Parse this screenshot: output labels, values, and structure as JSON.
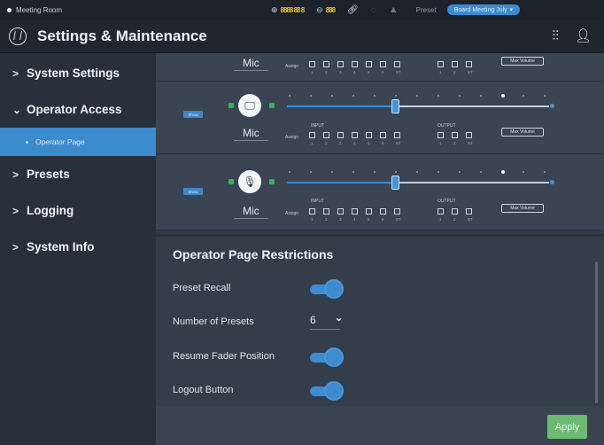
{
  "status_bar": {
    "room": "Meeting Room",
    "input_meter": "8888 88 8",
    "output_meter": "888",
    "preset_label": "Preset",
    "preset_value": "Board Meeting July"
  },
  "header": {
    "title": "Settings & Maintenance"
  },
  "sidebar": {
    "items": [
      {
        "label": "System Settings",
        "chevron": ">"
      },
      {
        "label": "Operator Access",
        "chevron": "⌄"
      },
      {
        "label": "Operator Page"
      },
      {
        "label": "Presets",
        "chevron": ">"
      },
      {
        "label": "Logging",
        "chevron": ">"
      },
      {
        "label": "System Info",
        "chevron": ">"
      }
    ]
  },
  "channels": [
    {
      "label": "Mic",
      "assign": "Assign",
      "input_numbers": [
        "1",
        "2",
        "3",
        "4",
        "5",
        "6",
        "ST"
      ],
      "output_numbers": [
        "1",
        "2",
        "ST"
      ],
      "max_volume": "Max Volume"
    },
    {
      "label": "Mic",
      "icon": "monitor-icon",
      "show": "Show",
      "input_label": "INPUT",
      "output_label": "OUTPUT",
      "assign": "Assign",
      "input_numbers": [
        "1",
        "2",
        "3",
        "4",
        "5",
        "6",
        "ST"
      ],
      "output_numbers": [
        "1",
        "2",
        "ST"
      ],
      "max_volume": "Max Volume"
    },
    {
      "label": "Mic",
      "icon": "microphone-icon",
      "show": "Show",
      "input_label": "INPUT",
      "output_label": "OUTPUT",
      "assign": "Assign",
      "input_numbers": [
        "1",
        "2",
        "3",
        "4",
        "5",
        "6",
        "ST"
      ],
      "output_numbers": [
        "1",
        "2",
        "ST"
      ],
      "max_volume": "Max Volume"
    }
  ],
  "restrictions": {
    "title": "Operator Page Restrictions",
    "preset_recall": {
      "label": "Preset Recall",
      "on": true
    },
    "number_of_presets": {
      "label": "Number of Presets",
      "value": "6"
    },
    "resume_fader": {
      "label": "Resume Fader Position",
      "on": true
    },
    "logout_button": {
      "label": "Logout Button",
      "on": true
    }
  },
  "footer": {
    "apply": "Apply"
  },
  "colors": {
    "accent": "#3e8bd0",
    "apply": "#6cbb72",
    "meter": "#e9c23c"
  }
}
